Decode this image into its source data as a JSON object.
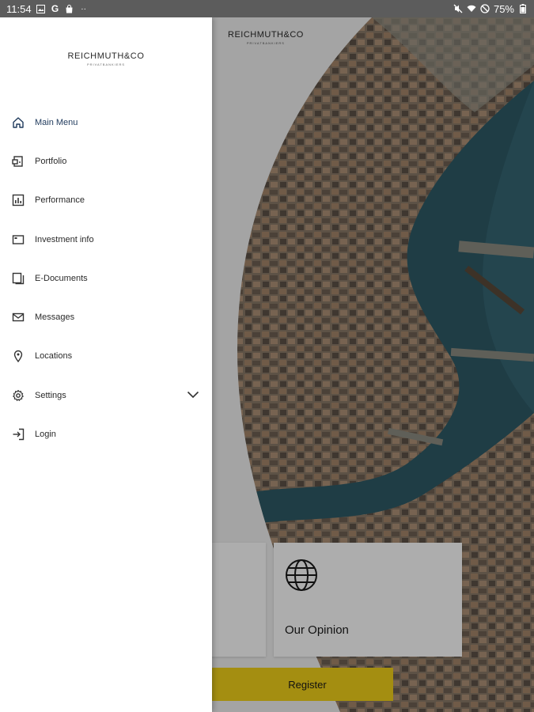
{
  "status_bar": {
    "time": "11:54",
    "battery": "75%"
  },
  "brand": {
    "name": "REICHMUTH&CO",
    "tagline": "PRIVATBANKIERS"
  },
  "drawer": {
    "items": [
      {
        "label": "Main Menu",
        "icon": "home-icon",
        "active": true
      },
      {
        "label": "Portfolio",
        "icon": "portfolio-icon"
      },
      {
        "label": "Performance",
        "icon": "bar-chart-icon"
      },
      {
        "label": "Investment info",
        "icon": "info-card-icon"
      },
      {
        "label": "E-Documents",
        "icon": "documents-icon"
      },
      {
        "label": "Messages",
        "icon": "mail-icon"
      },
      {
        "label": "Locations",
        "icon": "location-pin-icon"
      },
      {
        "label": "Settings",
        "icon": "gear-icon",
        "expandable": true
      },
      {
        "label": "Login",
        "icon": "login-icon"
      }
    ]
  },
  "content": {
    "opinion_card_label": "Our Opinion",
    "register_label": "Register"
  },
  "colors": {
    "accent_yellow": "#f2d21a",
    "active_text": "#1f3a5c",
    "status_bar": "#5c5c5c"
  }
}
